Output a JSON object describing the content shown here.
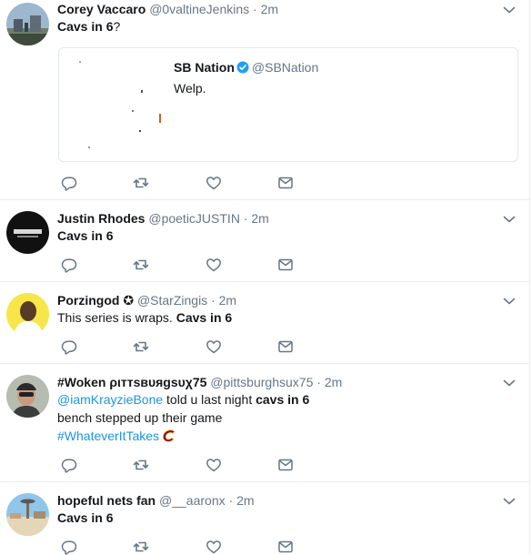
{
  "colors": {
    "accent": "#1b95e0",
    "text": "#14171a",
    "muted": "#657786",
    "border": "#e6ecf0",
    "cavs_wine": "#860038",
    "cavs_gold": "#FDBB30"
  },
  "icons": {
    "reply": "reply-icon",
    "retweet": "retweet-icon",
    "like": "heart-icon",
    "dm": "envelope-icon",
    "caret": "chevron-down-icon",
    "verified": "verified-badge-icon",
    "emoji": "cavaliers-c-emoji"
  },
  "tweets": [
    {
      "name": "Corey Vaccaro",
      "handle": "@0valtineJenkins",
      "dot": "·",
      "time": "2m",
      "text_bold": "Cavs in 6",
      "text_rest": "?",
      "quote": {
        "name": "SB Nation",
        "handle": "@SBNation",
        "text": "Welp."
      }
    },
    {
      "name": "Justin Rhodes",
      "handle": "@poeticJUSTIN",
      "dot": "·",
      "time": "2m",
      "text_bold": "Cavs in 6"
    },
    {
      "name": "Porzingod",
      "name_symbol": "✪",
      "handle": "@StarZingis",
      "dot": "·",
      "time": "2m",
      "text_plain": "This series is wraps.",
      "text_bold": "Cavs in 6"
    },
    {
      "name": "#Woken ριттѕвυяgѕυχ75",
      "handle": "@pittsburghsux75",
      "dot": "·",
      "time": "2m",
      "mention": "@iamKrayzieBone",
      "line1_plain": "told u last night",
      "line1_bold": "cavs in 6",
      "line2": "bench stepped up their game",
      "hashtag": "#WhateverItTakes"
    },
    {
      "name": "hopeful nets fan",
      "handle": "@__aaronx",
      "dot": "·",
      "time": "2m",
      "text_bold": "Cavs in 6"
    }
  ]
}
